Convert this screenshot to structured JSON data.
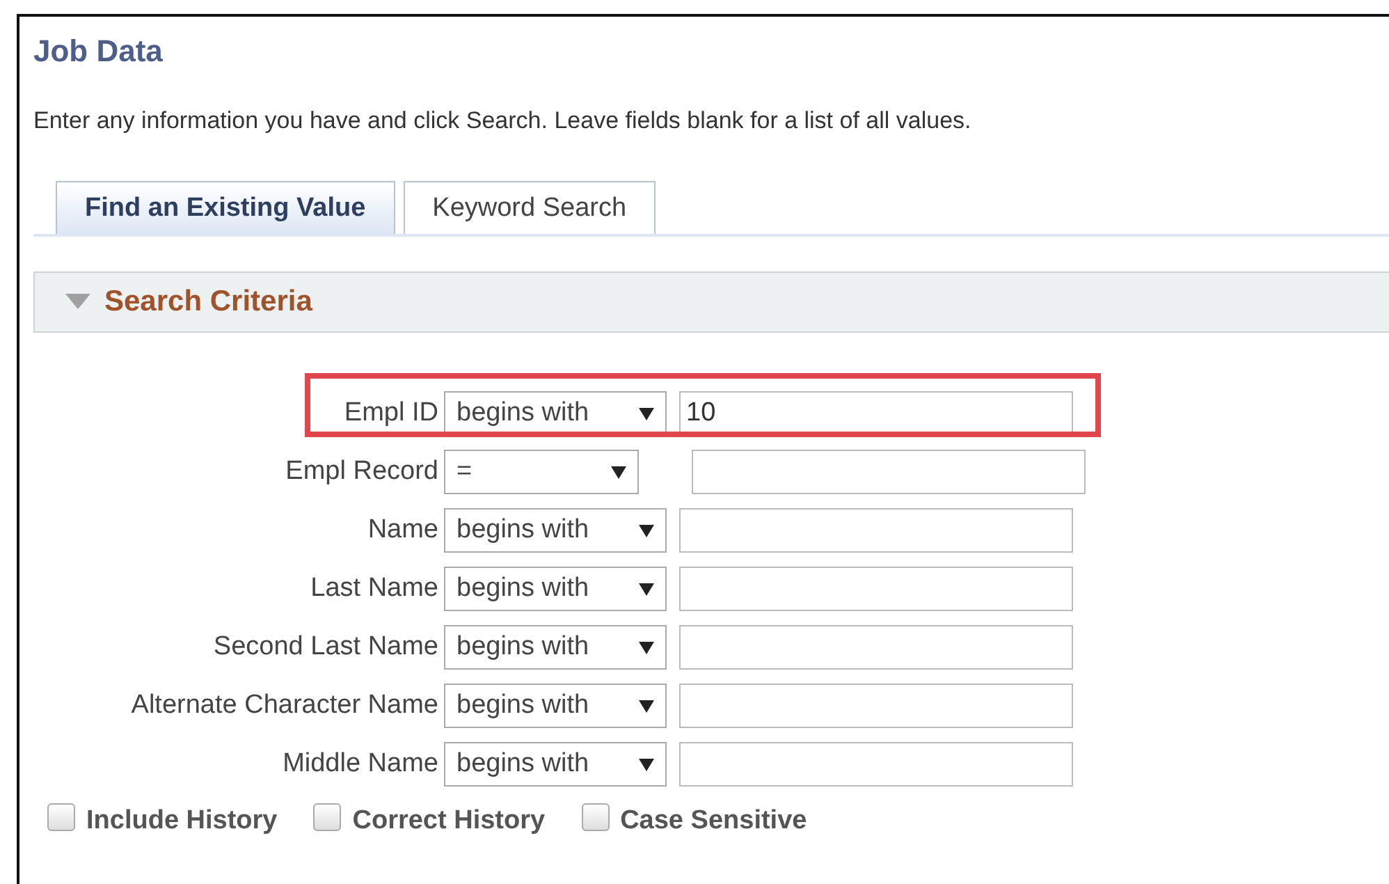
{
  "page": {
    "title": "Job Data",
    "instructions": "Enter any information you have and click Search. Leave fields blank for a list of all values."
  },
  "tabs": [
    {
      "label": "Find an Existing Value",
      "selected": true
    },
    {
      "label": "Keyword Search",
      "selected": false
    }
  ],
  "section": {
    "title": "Search Criteria",
    "expanded": true
  },
  "fields": [
    {
      "label": "Empl ID",
      "operator": "begins with",
      "value": "10",
      "kind": "text",
      "highlighted": true
    },
    {
      "label": "Empl Record",
      "operator": "=",
      "kind": "number",
      "highlighted": false
    },
    {
      "label": "Name",
      "operator": "begins with",
      "kind": "text",
      "highlighted": false
    },
    {
      "label": "Last Name",
      "operator": "begins with",
      "kind": "text",
      "highlighted": false
    },
    {
      "label": "Second Last Name",
      "operator": "begins with",
      "kind": "text",
      "highlighted": false
    },
    {
      "label": "Alternate Character Name",
      "operator": "begins with",
      "kind": "text",
      "highlighted": false
    },
    {
      "label": "Middle Name",
      "operator": "begins with",
      "kind": "text",
      "highlighted": false
    }
  ],
  "options": [
    {
      "label": "Include History",
      "checked": false
    },
    {
      "label": "Correct History",
      "checked": false
    },
    {
      "label": "Case Sensitive",
      "checked": false
    }
  ]
}
